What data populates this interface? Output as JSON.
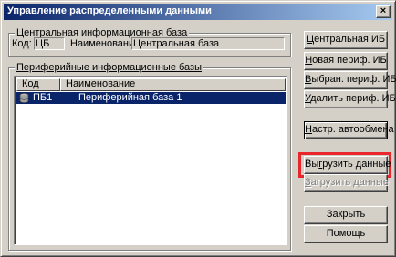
{
  "window": {
    "title": "Управление распределенными данными",
    "close_glyph": "×"
  },
  "central": {
    "group_title": "Центральная информационная база",
    "code_label": "Код:",
    "code_value": "ЦБ",
    "name_label": "Наименование:",
    "name_value": "Центральная база"
  },
  "peripheral": {
    "group_title": "Периферийные информационные базы",
    "columns": [
      "Код",
      "Наименование"
    ],
    "rows": [
      {
        "code": "ПБ1",
        "name": "Периферийная база 1",
        "selected": true,
        "icon": "database-icon"
      }
    ]
  },
  "buttons": {
    "central_ib": {
      "u": "Ц",
      "rest": "ентральная ИБ"
    },
    "new_periph": {
      "u": "Н",
      "rest": "овая периф. ИБ"
    },
    "selected_periph": {
      "u": "В",
      "rest": "ыбран. периф. ИБ"
    },
    "delete_periph": {
      "u": "У",
      "rest": "далить периф. ИБ"
    },
    "auto_exchange": {
      "u": "Н",
      "rest": "астр. автообмена"
    },
    "upload_data": {
      "pre": "Вы",
      "u": "г",
      "rest": "рузить данные"
    },
    "download_data": {
      "u": "З",
      "rest": "агрузить данные"
    },
    "close": {
      "label": "Закрыть"
    },
    "help": {
      "label": "Помощь"
    }
  },
  "colors": {
    "face": "#d4d0c8",
    "title_start": "#0a246a",
    "title_end": "#a6caf0",
    "selection": "#0a246a",
    "highlight_frame": "#e8262c"
  }
}
